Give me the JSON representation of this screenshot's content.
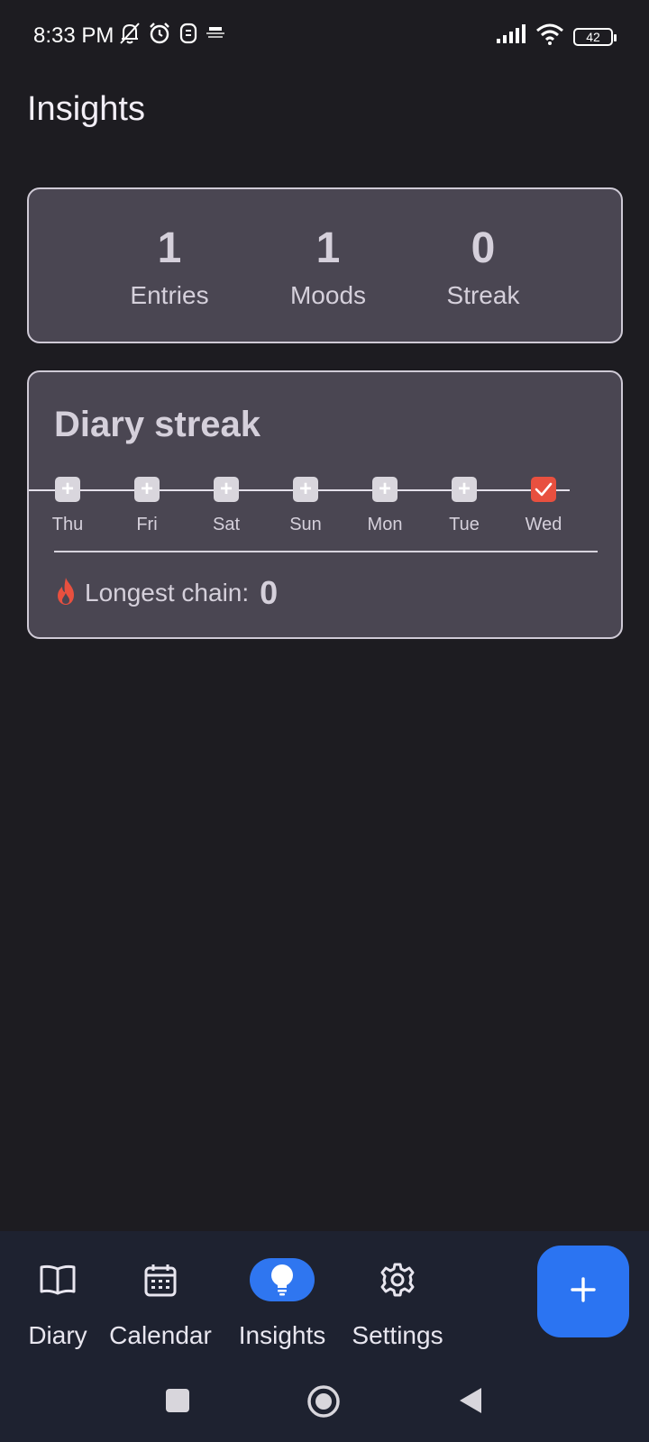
{
  "status_bar": {
    "time": "8:33 PM",
    "battery": "42"
  },
  "page": {
    "title": "Insights"
  },
  "stats": [
    {
      "value": "1",
      "label": "Entries"
    },
    {
      "value": "1",
      "label": "Moods"
    },
    {
      "value": "0",
      "label": "Streak"
    }
  ],
  "streak": {
    "title": "Diary streak",
    "days": [
      {
        "label": "Thu",
        "done": false
      },
      {
        "label": "Fri",
        "done": false
      },
      {
        "label": "Sat",
        "done": false
      },
      {
        "label": "Sun",
        "done": false
      },
      {
        "label": "Mon",
        "done": false
      },
      {
        "label": "Tue",
        "done": false
      },
      {
        "label": "Wed",
        "done": true
      }
    ],
    "longest_label": "Longest chain:",
    "longest_value": "0",
    "accent_color": "#e8503f"
  },
  "bottom_nav": {
    "items": [
      {
        "label": "Diary",
        "icon": "book-icon",
        "active": false
      },
      {
        "label": "Calendar",
        "icon": "calendar-icon",
        "active": false
      },
      {
        "label": "Insights",
        "icon": "lightbulb-icon",
        "active": true
      },
      {
        "label": "Settings",
        "icon": "gear-icon",
        "active": false
      }
    ],
    "fab_icon": "plus-icon",
    "active_color": "#2f76f0"
  },
  "system_nav": {
    "icons": [
      "recents-icon",
      "home-icon",
      "back-icon"
    ]
  }
}
